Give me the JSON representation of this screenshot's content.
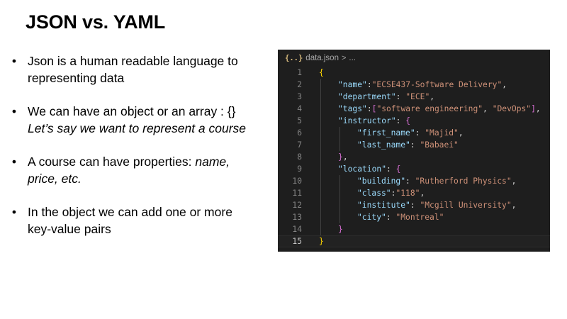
{
  "slide": {
    "title": "JSON vs. YAML",
    "bullets": [
      {
        "line1": "Json is a human readable language to",
        "line2": "representing data"
      },
      {
        "line1": "We can have an object or an array : {}",
        "line2_italic": "Let’s say we want to represent a course"
      },
      {
        "line1": "A course can have properties: ",
        "line1_italic": "name,",
        "line2_italic": "price, etc."
      },
      {
        "line1": "In the object we can add one or more",
        "line2": "key-value pairs"
      }
    ],
    "bullet_glyph": "•"
  },
  "editor": {
    "file_icon": "{..}",
    "file_name": "data.json",
    "crumb_chevron": ">",
    "crumb_more": "...",
    "lines": [
      {
        "n": "1",
        "indent": 0,
        "tokens": [
          [
            "b1",
            "{"
          ]
        ]
      },
      {
        "n": "2",
        "indent": 1,
        "tokens": [
          [
            "key",
            "\"name\""
          ],
          [
            "p",
            ":"
          ],
          [
            "str",
            "\"ECSE437-Software Delivery\""
          ],
          [
            "p",
            ","
          ]
        ]
      },
      {
        "n": "3",
        "indent": 1,
        "tokens": [
          [
            "key",
            "\"department\""
          ],
          [
            "p",
            ": "
          ],
          [
            "str",
            "\"ECE\""
          ],
          [
            "p",
            ","
          ]
        ]
      },
      {
        "n": "4",
        "indent": 1,
        "tokens": [
          [
            "key",
            "\"tags\""
          ],
          [
            "p",
            ":"
          ],
          [
            "b2",
            "["
          ],
          [
            "str",
            "\"software engineering\""
          ],
          [
            "p",
            ", "
          ],
          [
            "str",
            "\"DevOps\""
          ],
          [
            "b2",
            "]"
          ],
          [
            "p",
            ","
          ]
        ]
      },
      {
        "n": "5",
        "indent": 1,
        "tokens": [
          [
            "key",
            "\"instructor\""
          ],
          [
            "p",
            ": "
          ],
          [
            "b2",
            "{"
          ]
        ]
      },
      {
        "n": "6",
        "indent": 2,
        "tokens": [
          [
            "key",
            "\"first_name\""
          ],
          [
            "p",
            ": "
          ],
          [
            "str",
            "\"Majid\""
          ],
          [
            "p",
            ","
          ]
        ]
      },
      {
        "n": "7",
        "indent": 2,
        "tokens": [
          [
            "key",
            "\"last_name\""
          ],
          [
            "p",
            ": "
          ],
          [
            "str",
            "\"Babaei\""
          ]
        ]
      },
      {
        "n": "8",
        "indent": 1,
        "tokens": [
          [
            "b2",
            "}"
          ],
          [
            "p",
            ","
          ]
        ]
      },
      {
        "n": "9",
        "indent": 1,
        "tokens": [
          [
            "key",
            "\"location\""
          ],
          [
            "p",
            ": "
          ],
          [
            "b2",
            "{"
          ]
        ]
      },
      {
        "n": "10",
        "indent": 2,
        "tokens": [
          [
            "key",
            "\"building\""
          ],
          [
            "p",
            ": "
          ],
          [
            "str",
            "\"Rutherford Physics\""
          ],
          [
            "p",
            ","
          ]
        ]
      },
      {
        "n": "11",
        "indent": 2,
        "tokens": [
          [
            "key",
            "\"class\""
          ],
          [
            "p",
            ":"
          ],
          [
            "str",
            "\"118\""
          ],
          [
            "p",
            ","
          ]
        ]
      },
      {
        "n": "12",
        "indent": 2,
        "tokens": [
          [
            "key",
            "\"institute\""
          ],
          [
            "p",
            ": "
          ],
          [
            "str",
            "\"Mcgill University\""
          ],
          [
            "p",
            ","
          ]
        ]
      },
      {
        "n": "13",
        "indent": 2,
        "tokens": [
          [
            "key",
            "\"city\""
          ],
          [
            "p",
            ": "
          ],
          [
            "str",
            "\"Montreal\""
          ]
        ]
      },
      {
        "n": "14",
        "indent": 1,
        "tokens": [
          [
            "b2",
            "}"
          ]
        ]
      },
      {
        "n": "15",
        "indent": 0,
        "tokens": [
          [
            "b1",
            "}"
          ]
        ],
        "current": true
      }
    ]
  },
  "colors": {
    "editor_bg": "#1e1e1e",
    "key": "#9cdcfe",
    "string": "#ce9178",
    "bracket_level1": "#ffd700",
    "bracket_level2": "#da70d6"
  }
}
